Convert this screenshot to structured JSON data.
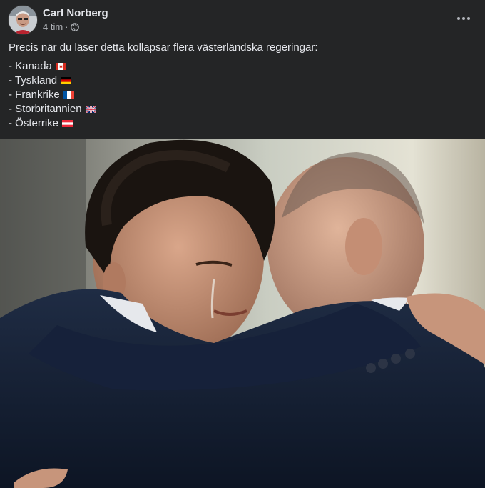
{
  "post": {
    "author": "Carl Norberg",
    "time": "4 tim",
    "separator": "·",
    "audience_icon": "globe-icon",
    "more_icon": "more-options-icon",
    "intro_text": "Precis när du läser detta kollapsar flera västerländska regeringar:",
    "items": [
      {
        "label": "- Kanada",
        "flag": "flag-canada-icon"
      },
      {
        "label": "- Tyskland",
        "flag": "flag-germany-icon"
      },
      {
        "label": "- Frankrike",
        "flag": "flag-france-icon"
      },
      {
        "label": "- Storbritannien",
        "flag": "flag-uk-icon"
      },
      {
        "label": "- Österrike",
        "flag": "flag-austria-icon"
      }
    ],
    "photo_icon": "post-photo"
  },
  "colors": {
    "card_bg": "#242526",
    "primary_text": "#e4e6eb",
    "secondary_text": "#b0b3b8"
  }
}
